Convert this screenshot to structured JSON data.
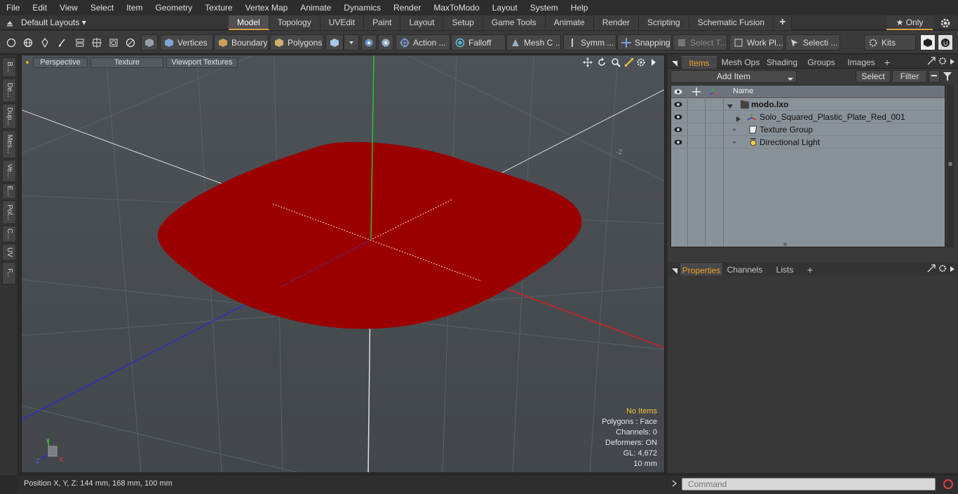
{
  "menu": [
    "File",
    "Edit",
    "View",
    "Select",
    "Item",
    "Geometry",
    "Texture",
    "Vertex Map",
    "Animate",
    "Dynamics",
    "Render",
    "MaxToModo",
    "Layout",
    "System",
    "Help"
  ],
  "layout_dropdown": "Default Layouts ▾",
  "tabs": [
    "Model",
    "Topology",
    "UVEdit",
    "Paint",
    "Layout",
    "Setup",
    "Game Tools",
    "Animate",
    "Render",
    "Scripting",
    "Schematic Fusion"
  ],
  "only_label": "★  Only",
  "toolbar": {
    "vertices": "Vertices",
    "boundary": "Boundary",
    "polygons": "Polygons",
    "action": "Action  ...",
    "falloff": "Falloff",
    "mesh": "Mesh C ...",
    "symm": "Symm ...",
    "snapping": "Snapping",
    "select_t": "Select T...",
    "work_pl": "Work Pl...",
    "selecti": "Selecti ...",
    "kits": "Kits"
  },
  "left_tabs": [
    "B...",
    "De...",
    "Dup...",
    "Mes...",
    "Ve...",
    "E...",
    "Pol...",
    "C...",
    "UV",
    "F..."
  ],
  "viewport": {
    "perspective": "Perspective",
    "texture": "Texture",
    "viewport_textures": "Viewport Textures",
    "axis_label": "-Z",
    "info": {
      "no_items": "No Items",
      "polygons": "Polygons : Face",
      "channels": "Channels: 0",
      "deformers": "Deformers: ON",
      "gl": "GL: 4,672",
      "scale": "10 mm"
    }
  },
  "items_panel": {
    "tabs": [
      "Items",
      "Mesh Ops",
      "Shading",
      "Groups",
      "Images"
    ],
    "add_item": "Add Item",
    "select": "Select",
    "filter": "Filter",
    "name_header": "Name",
    "rows": [
      {
        "label": "modo.lxo"
      },
      {
        "label": "Solo_Squared_Plastic_Plate_Red_001"
      },
      {
        "label": "Texture Group"
      },
      {
        "label": "Directional Light"
      }
    ]
  },
  "props_panel": {
    "tabs": [
      "Properties",
      "Channels",
      "Lists"
    ]
  },
  "status": {
    "position": "Position X, Y, Z:   144 mm, 168 mm, 100 mm"
  },
  "command": {
    "placeholder": "Command"
  },
  "colors": {
    "plate": "#9b0000",
    "accent": "#f0a030",
    "axis_x": "#d02020",
    "axis_y": "#30c030",
    "axis_z": "#2020c0"
  }
}
